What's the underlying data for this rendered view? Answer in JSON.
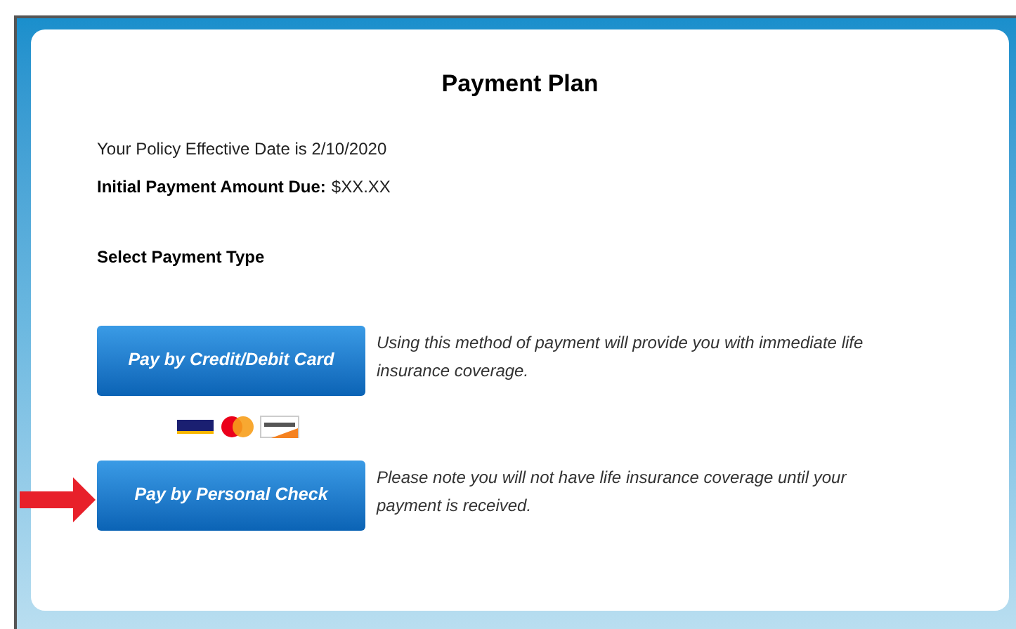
{
  "title": "Payment Plan",
  "effective_date": "Your Policy Effective Date is 2/10/2020",
  "amount_due": {
    "label": "Initial Payment Amount Due:",
    "value": "$XX.XX"
  },
  "section_heading": "Select Payment Type",
  "options": [
    {
      "kind": "card",
      "button": "Pay by Credit/Debit Card",
      "description": "Using this method of payment will provide you with immediate life insurance coverage.",
      "highlighted": false
    },
    {
      "kind": "check",
      "button": "Pay by Personal Check",
      "description": "Please note you will not have life insurance coverage until your payment is received.",
      "highlighted": true
    }
  ]
}
